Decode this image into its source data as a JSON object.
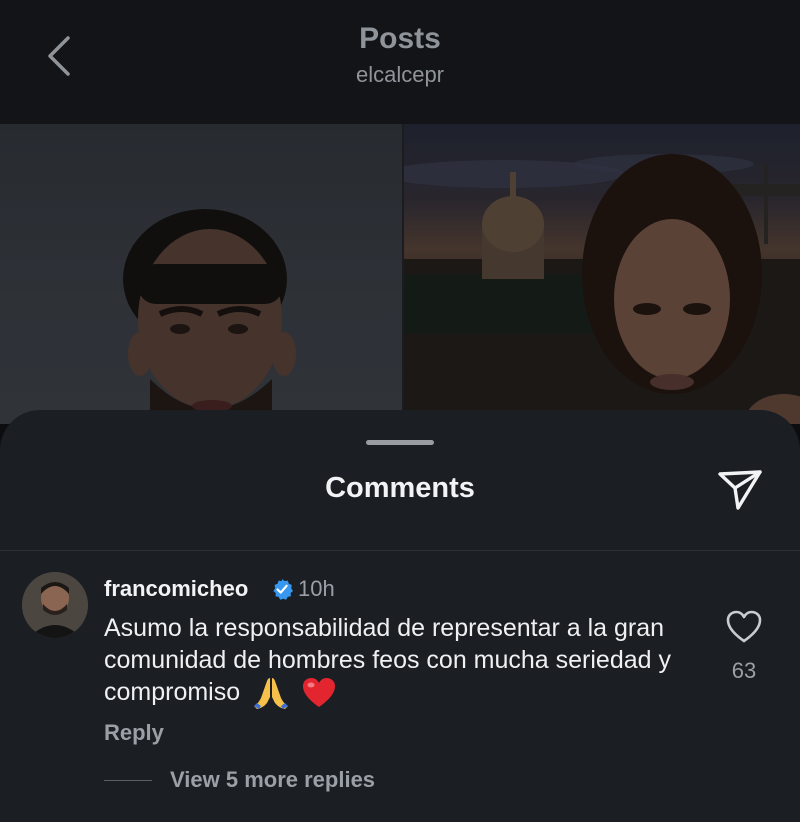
{
  "header": {
    "title": "Posts",
    "username": "elcalcepr",
    "back_icon": "chevron-left-icon"
  },
  "post": {
    "images": [
      "man-portrait-photo",
      "woman-portrait-photo"
    ]
  },
  "comments_sheet": {
    "title": "Comments",
    "share_icon": "paper-plane-icon",
    "comments": [
      {
        "username": "francomicheo",
        "verified": true,
        "time": "10h",
        "text": "Asumo la responsabilidad de representar a la gran comunidad de hombres feos con mucha seriedad y compromiso",
        "emojis": [
          "folded-hands-emoji",
          "red-heart-emoji"
        ],
        "reply_label": "Reply",
        "like_count": "63",
        "view_more_label": "View 5 more replies"
      }
    ]
  },
  "colors": {
    "header_bg": "#121417",
    "sheet_bg": "#1b1e22",
    "text_primary": "#f2f3f5",
    "text_secondary": "#9aa0a6",
    "verified_blue": "#3897f0",
    "heart_red": "#e3252f"
  }
}
